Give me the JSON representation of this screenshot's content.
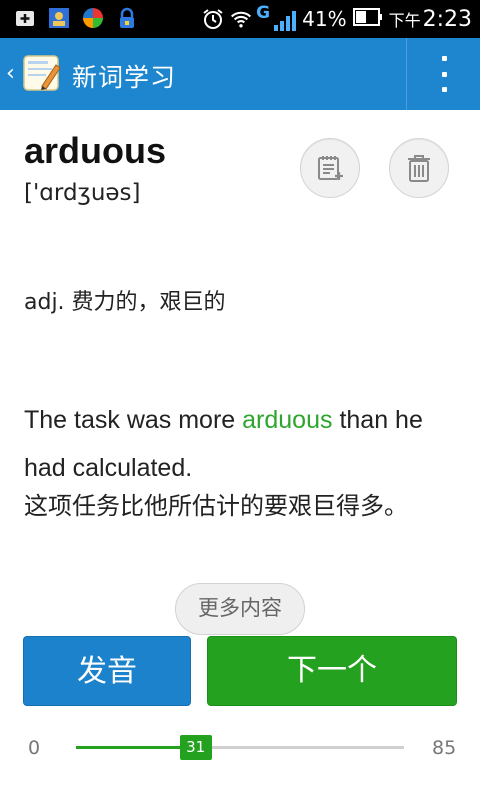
{
  "status_bar": {
    "battery_percent": "41%",
    "time_prefix": "下午",
    "time": "2:23",
    "network_label": "G",
    "icons": [
      "plus-square-icon",
      "contact-card-icon",
      "pinwheel-app-icon",
      "lock-app-icon",
      "alarm-icon",
      "wifi-icon",
      "signal-icon",
      "battery-icon"
    ]
  },
  "title_bar": {
    "title": "新词学习",
    "back_icon": "chevron-left-icon",
    "menu_icon": "overflow-menu-icon"
  },
  "word": {
    "text": "arduous",
    "phonetic": "['ɑrdʒuəs]",
    "meaning": "adj. 费力的，艰巨的"
  },
  "example": {
    "en_before": "The task was more ",
    "en_highlight": "arduous",
    "en_after": " than he had calculated.",
    "cn": "这项任务比他所估计的要艰巨得多。"
  },
  "actions": {
    "more": "更多内容",
    "pronounce": "发音",
    "next": "下一个"
  },
  "progress": {
    "min": "0",
    "max": "85",
    "current": "31",
    "current_value": 31,
    "max_value": 85
  },
  "colors": {
    "title_bar": "#1d86cf",
    "accent_green": "#23a11f",
    "button_blue": "#1b82cb"
  }
}
